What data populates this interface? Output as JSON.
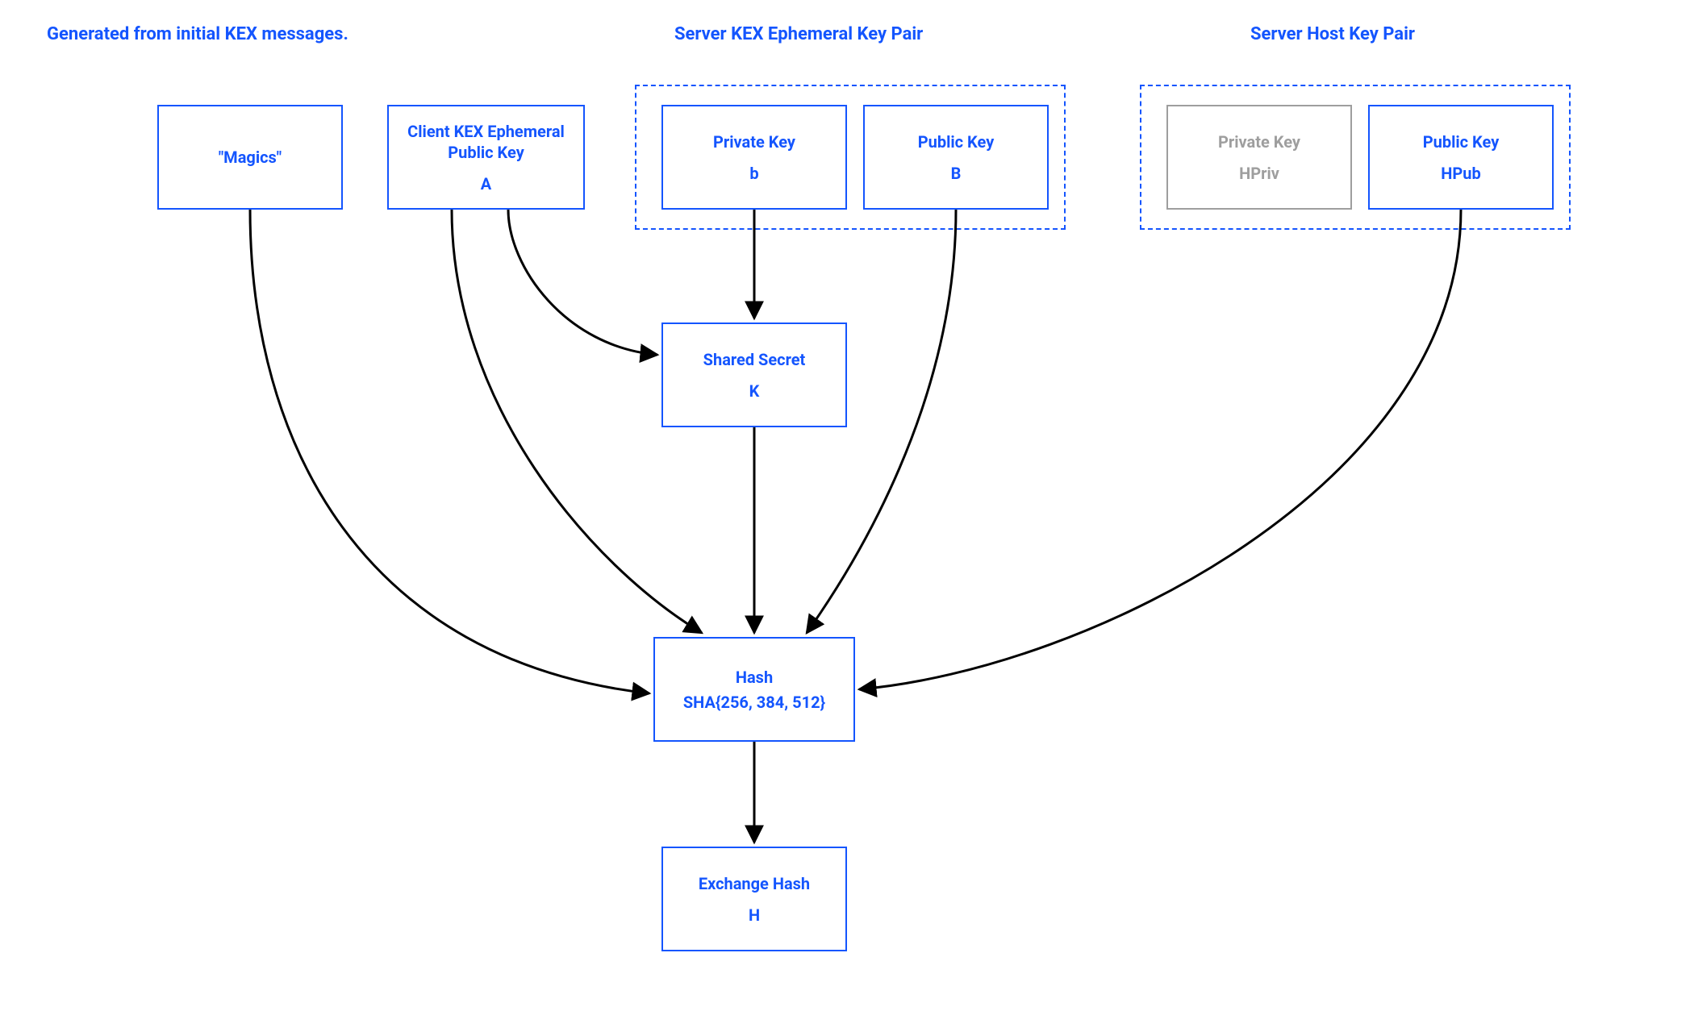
{
  "headings": {
    "generated": "Generated from initial KEX messages.",
    "serverKex": "Server KEX Ephemeral Key Pair",
    "serverHost": "Server Host Key Pair"
  },
  "boxes": {
    "magics": {
      "title": "\"Magics\""
    },
    "clientKex": {
      "title": "Client KEX Ephemeral Public Key",
      "sub": "A"
    },
    "privB": {
      "title": "Private Key",
      "sub": "b"
    },
    "pubB": {
      "title": "Public Key",
      "sub": "B"
    },
    "hpriv": {
      "title": "Private Key",
      "sub": "HPriv"
    },
    "hpub": {
      "title": "Public Key",
      "sub": "HPub"
    },
    "shared": {
      "title": "Shared Secret",
      "sub": "K"
    },
    "hash": {
      "title": "Hash",
      "sub": "SHA{256, 384, 512}"
    },
    "exch": {
      "title": "Exchange Hash",
      "sub": "H"
    }
  },
  "colors": {
    "primary": "#1455fe",
    "muted": "#9e9e9e",
    "arrow": "#000000"
  }
}
